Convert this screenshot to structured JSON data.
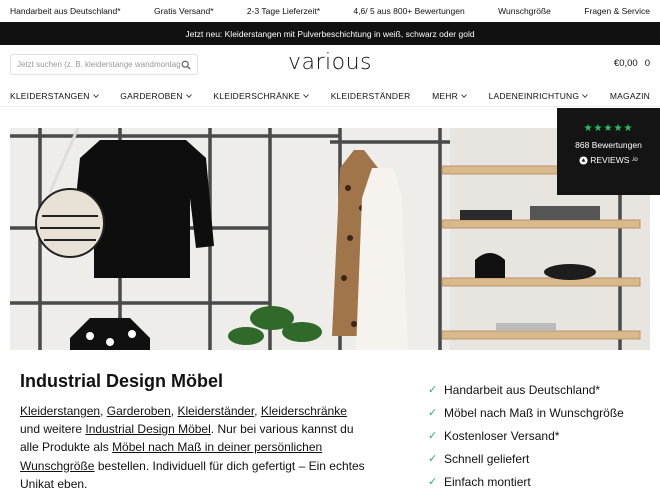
{
  "topbar": {
    "items": [
      "Handarbeit aus Deutschland*",
      "Gratis Versand*",
      "2-3 Tage Lieferzeit*",
      "4,6/ 5 aus 800+ Bewertungen",
      "Wunschgröße",
      "Fragen & Service"
    ]
  },
  "announcement": "Jetzt neu: Kleiderstangen mit Pulverbeschichtung in weiß, schwarz oder gold",
  "header": {
    "search_placeholder": "Jetzt suchen (z. B. kleiderstange wandmontage)",
    "search_icon": "search-icon",
    "logo": "various",
    "cart_total": "€0,00",
    "cart_count": "0"
  },
  "nav": {
    "items": [
      {
        "label": "KLEIDERSTANGEN",
        "dropdown": true
      },
      {
        "label": "GARDEROBEN",
        "dropdown": true
      },
      {
        "label": "KLEIDERSCHRÄNKE",
        "dropdown": true
      },
      {
        "label": "KLEIDERSTÄNDER",
        "dropdown": false
      },
      {
        "label": "MEHR",
        "dropdown": true
      },
      {
        "label": "LADENEINRICHTUNG",
        "dropdown": true
      },
      {
        "label": "MAGAZIN",
        "dropdown": false
      }
    ]
  },
  "reviews_widget": {
    "rating_stars": 4.5,
    "count_label": "868 Bewertungen",
    "brand": "REVIEWS",
    "brand_suffix": ".io",
    "star_color": "#28c164"
  },
  "content": {
    "title": "Industrial Design Möbel",
    "intro": {
      "link1": "Kleiderstangen",
      "sep1": ", ",
      "link2": "Garderoben",
      "sep2": ", ",
      "link3": "Kleiderständer",
      "sep3": ",",
      "link4": "Kleiderschränke",
      "text1": " und weitere ",
      "link5": "Industrial Design Möbel",
      "text2": ". Nur bei various kannst du alle Produkte als ",
      "link6": "Möbel nach Maß in deiner persönlichen Wunschgröße",
      "text3": " bestellen. Individuell für dich gefertigt – Ein echtes Unikat eben."
    }
  },
  "usps": {
    "check_color": "#2eb35a",
    "items": [
      "Handarbeit aus Deutschland*",
      "Möbel nach Maß in Wunschgröße",
      "Kostenloser Versand*",
      "Schnell geliefert",
      "Einfach montiert"
    ]
  }
}
